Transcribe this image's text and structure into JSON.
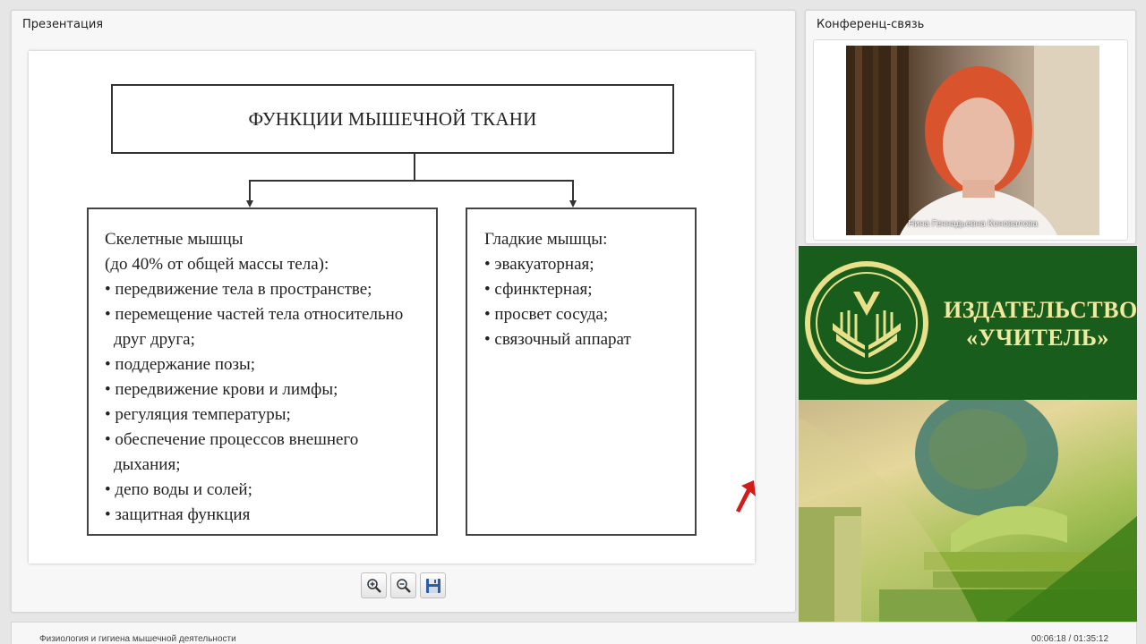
{
  "presentation": {
    "panel_title": "Презентация",
    "slide": {
      "title": "ФУНКЦИИ МЫШЕЧНОЙ ТКАНИ",
      "left_box": {
        "lines": [
          {
            "text": "Скелетные мышцы",
            "type": "heading"
          },
          {
            "text": "(до 40% от общей массы тела):",
            "type": "heading"
          },
          {
            "text": "• передвижение тела в пространстве;",
            "type": "item"
          },
          {
            "text": "• перемещение частей тела относительно",
            "type": "item"
          },
          {
            "text": "друг друга;",
            "type": "cont"
          },
          {
            "text": "• поддержание позы;",
            "type": "item"
          },
          {
            "text": "• передвижение крови и лимфы;",
            "type": "item"
          },
          {
            "text": "• регуляция температуры;",
            "type": "item"
          },
          {
            "text": "• обеспечение процессов внешнего",
            "type": "item"
          },
          {
            "text": "дыхания;",
            "type": "cont"
          },
          {
            "text": "• депо воды и солей;",
            "type": "item"
          },
          {
            "text": "• защитная функция",
            "type": "item"
          }
        ]
      },
      "right_box": {
        "lines": [
          {
            "text": "Гладкие мышцы:",
            "type": "heading"
          },
          {
            "text": "• эвакуаторная;",
            "type": "item"
          },
          {
            "text": "• сфинктерная;",
            "type": "item"
          },
          {
            "text": "• просвет сосуда;",
            "type": "item"
          },
          {
            "text": "• связочный аппарат",
            "type": "item"
          }
        ]
      }
    },
    "toolbar": {
      "zoom_in_icon": "zoom-in-icon",
      "zoom_out_icon": "zoom-out-icon",
      "save_icon": "floppy-disk-icon"
    }
  },
  "conference": {
    "panel_title": "Конференц-связь",
    "speaker_name": "Нина Геннадьевна Коновалова"
  },
  "banner": {
    "publisher_line1": "ИЗДАТЕЛЬСТВО",
    "publisher_line2": "«УЧИТЕЛЬ»",
    "colors": {
      "green": "#195d1c",
      "text": "#f0eaa0"
    }
  },
  "footer": {
    "course_title": "Физиология и гигиена мышечной деятельности",
    "time": "00:06:18 / 01:35:12"
  }
}
